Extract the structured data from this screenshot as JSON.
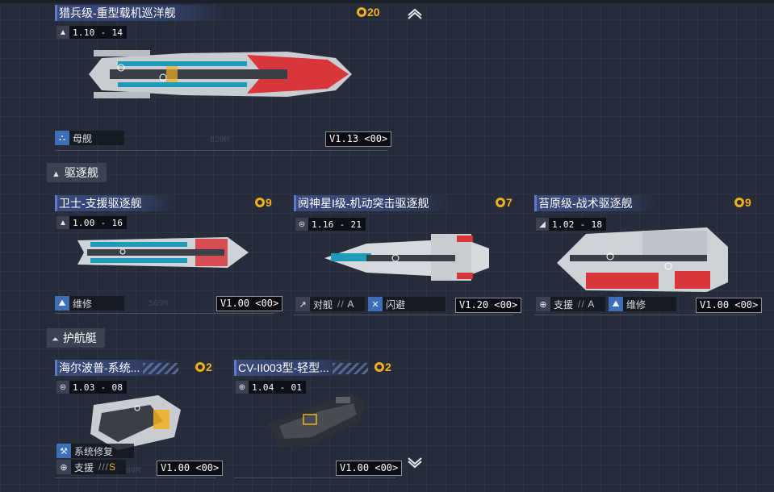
{
  "cards": {
    "carrier": {
      "title": "猎兵级-重型载机巡洋舰",
      "cost": "20",
      "version_tag": "1.10 - 14",
      "role": "母舰",
      "version": "V1.13 <00>"
    },
    "guard": {
      "title": "卫士-支援驱逐舰",
      "cost": "9",
      "version_tag": "1.00 - 16",
      "role": "维修",
      "version": "V1.00 <00>"
    },
    "yueshen": {
      "title": "阋神星I级-机动突击驱逐舰",
      "cost": "7",
      "version_tag": "1.16 - 21",
      "role1": "对舰",
      "role1_grade": "A",
      "role2": "闪避",
      "version": "V1.20 <00>"
    },
    "taiyuan": {
      "title": "苔原级-战术驱逐舰",
      "cost": "9",
      "version_tag": "1.02 - 18",
      "role1": "支援",
      "role1_grade": "A",
      "role2": "维修",
      "version": "V1.00 <00>"
    },
    "hairbop": {
      "title": "海尔波普-系统...",
      "cost": "2",
      "version_tag": "1.03 - 08",
      "role1": "系统修复",
      "role2": "支援",
      "role2_grade": "S",
      "version": "V1.00 <00>"
    },
    "cv": {
      "title": "CV-II003型-轻型...",
      "cost": "2",
      "version_tag": "1.04 - 01",
      "version": "V1.00 <00>"
    }
  },
  "sections": {
    "destroyer": "驱逐舰",
    "escort": "护航艇"
  },
  "nav": {
    "up": "scroll-up",
    "down": "scroll-down"
  }
}
